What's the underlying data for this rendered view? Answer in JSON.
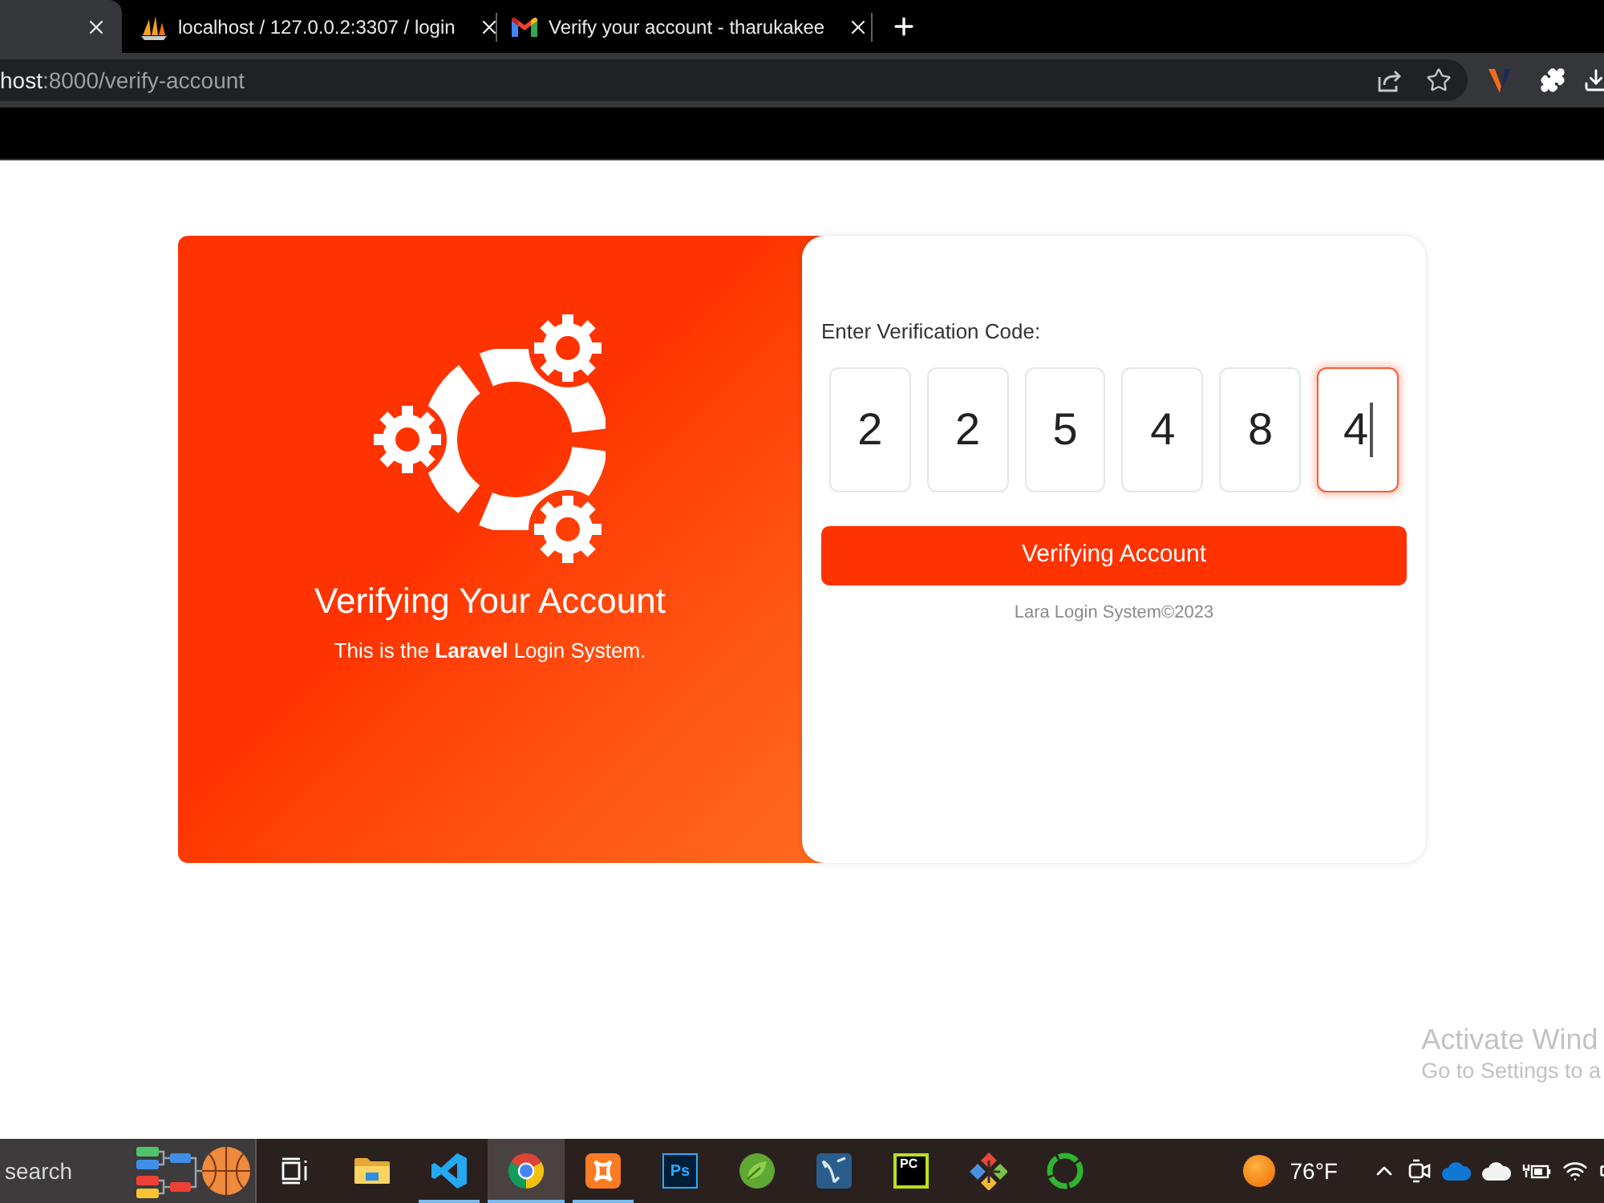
{
  "browser": {
    "tabs": [
      {
        "selected": true
      },
      {
        "title": "localhost / 127.0.0.2:3307 / login",
        "selected": false
      },
      {
        "title": "Verify your account - tharukakee",
        "selected": false
      }
    ],
    "address": {
      "host": "host",
      "path": ":8000/verify-account"
    }
  },
  "page": {
    "hero": {
      "title": "Verifying Your Account",
      "subtitle": "This is the **Laravel** Login System."
    },
    "form": {
      "label": "Enter Verification Code:",
      "digits": [
        {
          "value": "2",
          "focused": false
        },
        {
          "value": "2",
          "focused": false
        },
        {
          "value": "5",
          "focused": false
        },
        {
          "value": "4",
          "focused": false
        },
        {
          "value": "8",
          "focused": false
        },
        {
          "value": "4",
          "focused": true
        }
      ],
      "button": "Verifying Account",
      "footer": "Lara Login System©2023"
    }
  },
  "os_notice": {
    "title": "Activate Wind",
    "text": "Go to Settings to a"
  },
  "taskbar": {
    "search": {
      "placeholder": "search"
    },
    "apps": [
      {
        "running": false,
        "selected": false
      },
      {
        "running": false,
        "selected": false
      },
      {
        "running": true,
        "selected": false
      },
      {
        "running": true,
        "selected": true
      },
      {
        "running": true,
        "selected": false
      },
      {
        "label": "Ps",
        "running": false,
        "selected": false
      },
      {
        "running": false,
        "selected": false
      },
      {
        "running": false,
        "selected": false
      },
      {
        "label": "PC",
        "running": false,
        "selected": false
      },
      {
        "running": false,
        "selected": false
      },
      {
        "running": false,
        "selected": false
      }
    ],
    "weather": {
      "temperature": "76°F"
    }
  }
}
